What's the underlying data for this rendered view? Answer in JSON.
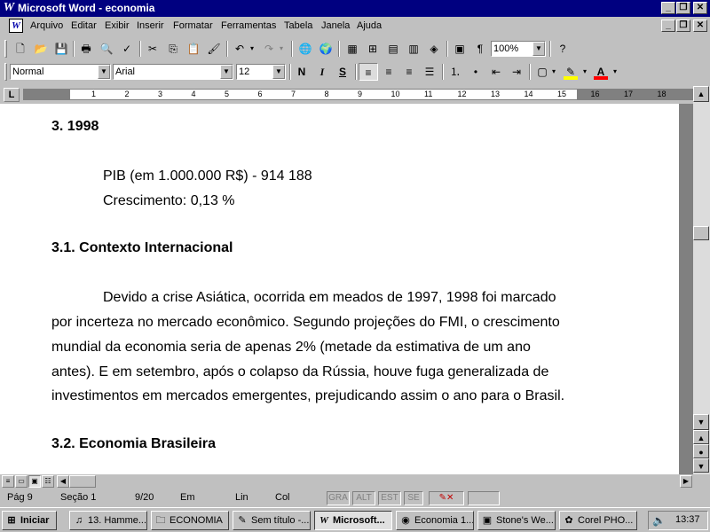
{
  "window": {
    "title": "Microsoft Word - economia",
    "app_icon": "word-icon"
  },
  "menu": [
    "Arquivo",
    "Editar",
    "Exibir",
    "Inserir",
    "Formatar",
    "Ferramentas",
    "Tabela",
    "Janela",
    "Ajuda"
  ],
  "toolbar": {
    "zoom": "100%"
  },
  "format": {
    "style": "Normal",
    "font": "Arial",
    "size": "12",
    "bold": "N",
    "italic": "I",
    "underline": "S",
    "font_color_hex": "#ff0000",
    "highlight_hex": "#ffff00"
  },
  "ruler": {
    "numbers": [
      "1",
      "2",
      "3",
      "4",
      "5",
      "6",
      "7",
      "8",
      "9",
      "10",
      "11",
      "12",
      "13",
      "14",
      "15",
      "16",
      "17",
      "18"
    ]
  },
  "document": {
    "heading1": "3.    1998",
    "pib": "PIB (em 1.000.000 R$) - 914 188",
    "crescimento": "Crescimento: 0,13 %",
    "heading2": "3.1.  Contexto Internacional",
    "para": [
      "Devido a crise Asiática, ocorrida em meados de 1997, 1998 foi marcado",
      "por incerteza no mercado econômico. Segundo projeções do FMI, o crescimento",
      "mundial da economia seria de apenas 2% (metade da estimativa de um ano",
      "antes). E em setembro, após o colapso da Rússia, houve fuga generalizada de",
      "investimentos em mercados emergentes, prejudicando assim o ano para o Brasil."
    ],
    "heading3": "3.2.  Economia Brasileira"
  },
  "status": {
    "pag": "Pág  9",
    "secao": "Seção  1",
    "pages": "9/20",
    "em": "Em",
    "lin": "Lin",
    "col": "Col",
    "flags": [
      "GRA",
      "ALT",
      "EST",
      "SE"
    ]
  },
  "taskbar": {
    "start": "Iniciar",
    "buttons": [
      "13. Hamme...",
      "ECONOMIA",
      "Sem título -...",
      "Microsoft...",
      "Economia 1...",
      "Stone's We...",
      "Corel PHO..."
    ],
    "clock": "13:37"
  }
}
